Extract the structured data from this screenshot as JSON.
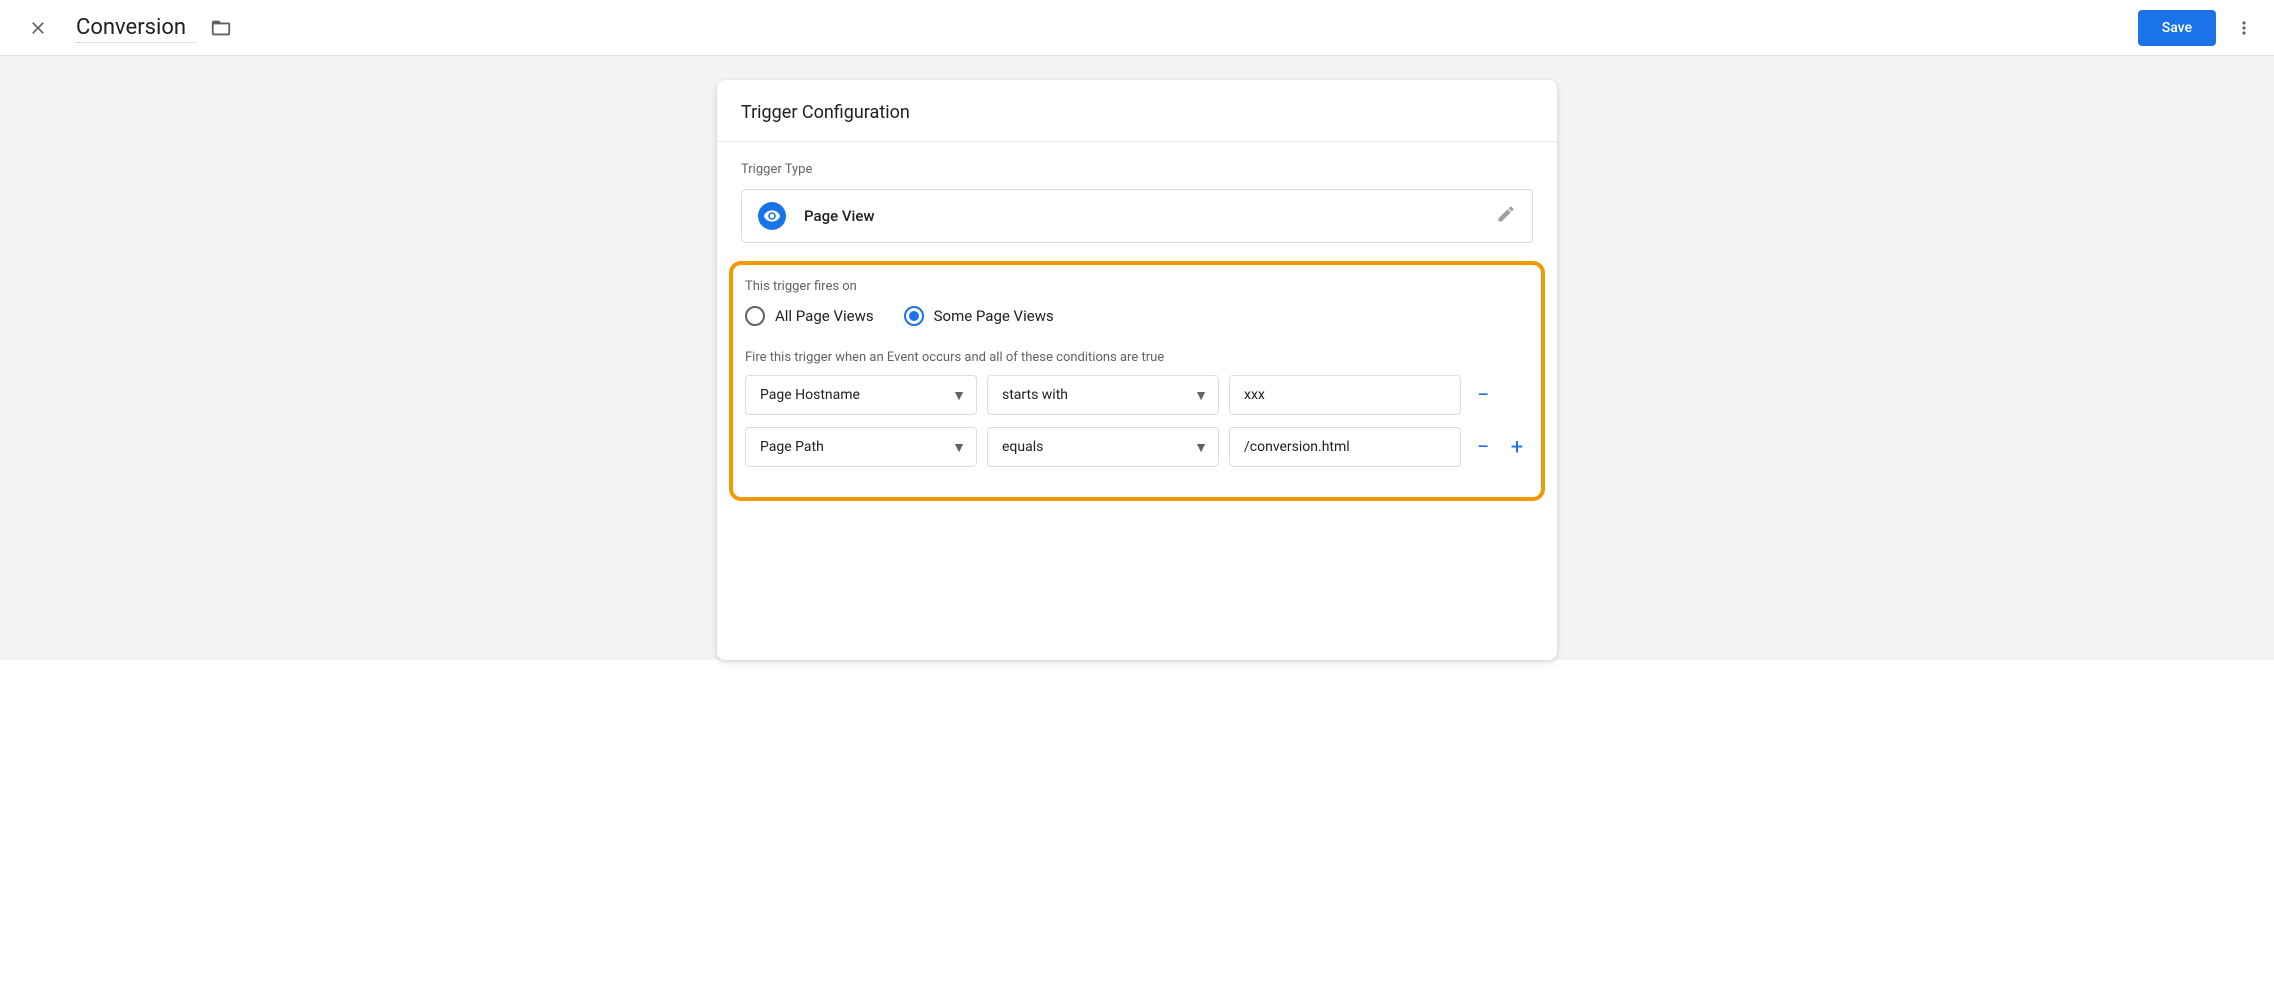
{
  "header": {
    "title": "Conversion",
    "save_label": "Save"
  },
  "card": {
    "title": "Trigger Configuration",
    "trigger_type_label": "Trigger Type",
    "trigger_type_name": "Page View"
  },
  "fires_on": {
    "label": "This trigger fires on",
    "option_all": "All Page Views",
    "option_some": "Some Page Views"
  },
  "conditions": {
    "label": "Fire this trigger when an Event occurs and all of these conditions are true",
    "rows": [
      {
        "variable": "Page Hostname",
        "operator": "starts with",
        "value": "xxx"
      },
      {
        "variable": "Page Path",
        "operator": "equals",
        "value": "/conversion.html"
      }
    ]
  }
}
